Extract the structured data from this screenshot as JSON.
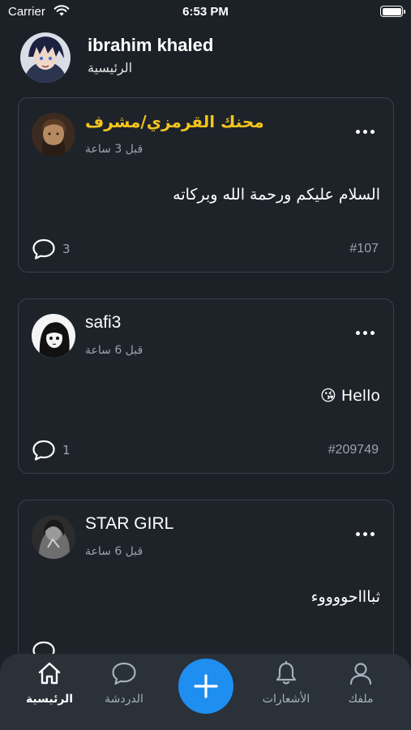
{
  "status_bar": {
    "carrier": "Carrier",
    "time": "6:53 PM"
  },
  "header": {
    "user_name": "ibrahim khaled",
    "subtitle": "الرئيسية"
  },
  "posts": [
    {
      "author": "محنك القرمزي/مشرف",
      "is_moderator": true,
      "time_ago": "قبل 3 ساعة",
      "body": "السلام عليكم ورحمة الله وبركاته",
      "comments": "3",
      "post_id": "#107"
    },
    {
      "author": "safi3",
      "is_moderator": false,
      "time_ago": "قبل 6 ساعة",
      "body": "Hello 😘",
      "comments": "1",
      "post_id": "#209749"
    },
    {
      "author": "STAR GIRL",
      "is_moderator": false,
      "time_ago": "قبل 6 ساعة",
      "body": "ثباااحووووء",
      "comments": "",
      "post_id": ""
    }
  ],
  "bottom_nav": {
    "items": [
      {
        "label": "الرئيسية",
        "icon": "home-icon",
        "active": true
      },
      {
        "label": "الدردشة",
        "icon": "chat-icon",
        "active": false
      },
      {
        "label": "الأشعارات",
        "icon": "bell-icon",
        "active": false
      },
      {
        "label": "ملفك",
        "icon": "profile-icon",
        "active": false
      }
    ],
    "fab_icon": "plus-icon"
  },
  "colors": {
    "background": "#1c2128",
    "moderator": "#f5c51b",
    "accent": "#1f8ef1",
    "nav_bg": "#2a3139"
  }
}
